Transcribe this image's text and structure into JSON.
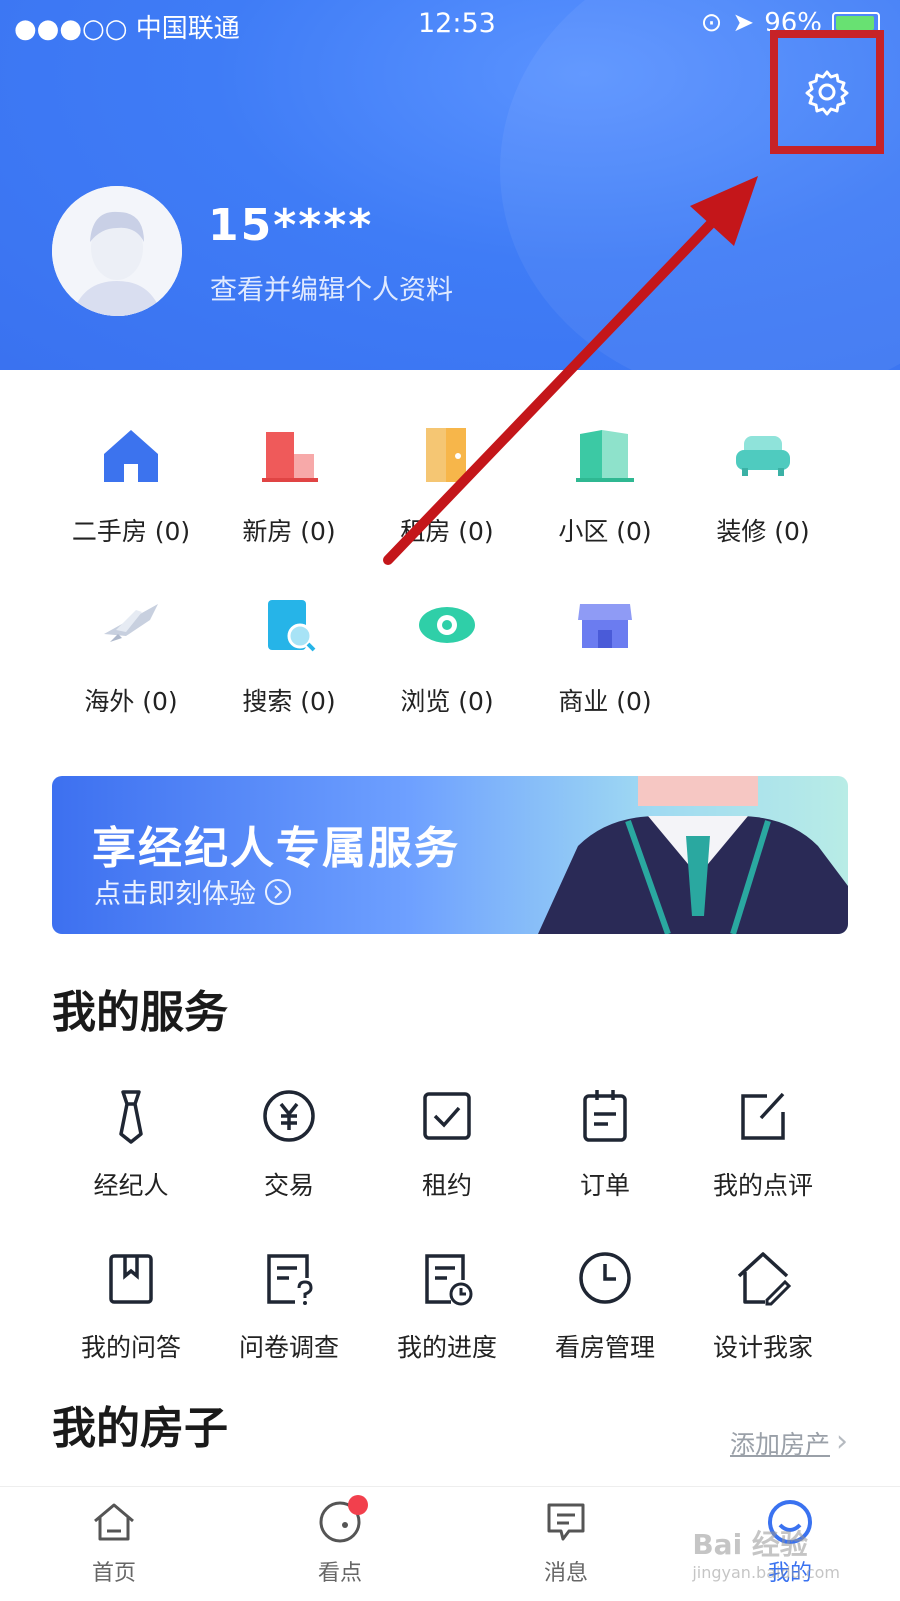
{
  "status_bar": {
    "carrier": "●●●○○ 中国联通",
    "time": "12:53",
    "battery": "96%",
    "battery_level": 0.96
  },
  "profile": {
    "username": "15****",
    "edit_label": "查看并编辑个人资料"
  },
  "quick_items": [
    {
      "label": "二手房 (0)",
      "icon": "house-icon"
    },
    {
      "label": "新房 (0)",
      "icon": "building-icon"
    },
    {
      "label": "租房 (0)",
      "icon": "door-icon"
    },
    {
      "label": "小区 (0)",
      "icon": "community-icon"
    },
    {
      "label": "装修 (0)",
      "icon": "sofa-icon"
    },
    {
      "label": "海外 (0)",
      "icon": "airplane-icon"
    },
    {
      "label": "搜索 (0)",
      "icon": "search-doc-icon"
    },
    {
      "label": "浏览 (0)",
      "icon": "eye-icon"
    },
    {
      "label": "商业 (0)",
      "icon": "store-icon"
    }
  ],
  "banner": {
    "title": "享经纪人专属服务",
    "subtitle": "点击即刻体验"
  },
  "services": {
    "title": "我的服务",
    "items": [
      {
        "label": "经纪人",
        "icon": "tie-icon"
      },
      {
        "label": "交易",
        "icon": "yuan-icon"
      },
      {
        "label": "租约",
        "icon": "checkbox-icon"
      },
      {
        "label": "订单",
        "icon": "clipboard-icon"
      },
      {
        "label": "我的点评",
        "icon": "edit-icon"
      },
      {
        "label": "我的问答",
        "icon": "bookmark-icon"
      },
      {
        "label": "问卷调查",
        "icon": "survey-icon"
      },
      {
        "label": "我的进度",
        "icon": "progress-icon"
      },
      {
        "label": "看房管理",
        "icon": "clock-icon"
      },
      {
        "label": "设计我家",
        "icon": "home-design-icon"
      }
    ]
  },
  "houses": {
    "title": "我的房子",
    "add_label": "添加房产"
  },
  "tabs": [
    {
      "label": "首页",
      "icon": "home-icon",
      "active": false
    },
    {
      "label": "看点",
      "icon": "discover-icon",
      "active": false,
      "badge": true
    },
    {
      "label": "消息",
      "icon": "message-icon",
      "active": false
    },
    {
      "label": "我的",
      "icon": "profile-icon",
      "active": true
    }
  ],
  "watermark": {
    "text": "Bai 经验",
    "sub": "jingyan.baidu.com"
  },
  "colors": {
    "primary": "#3a72f0",
    "highlight": "#c4161a",
    "badge": "#f2404d"
  }
}
